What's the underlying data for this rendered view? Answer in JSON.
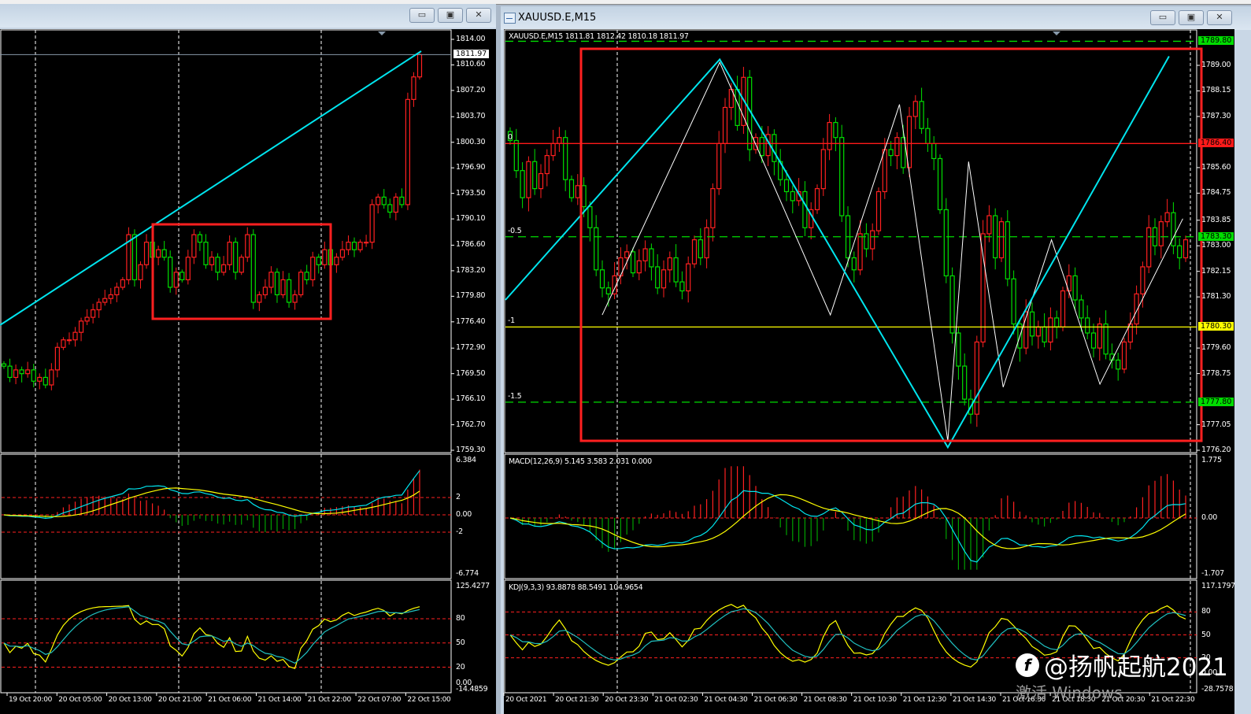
{
  "left_window": {
    "title": "",
    "buttons": {
      "minimize": "▭",
      "restore": "▣",
      "close": "✕"
    },
    "price_axis": [
      "1814.00",
      "1810.60",
      "1807.20",
      "1803.70",
      "1800.30",
      "1796.90",
      "1793.50",
      "1790.10",
      "1786.60",
      "1783.20",
      "1779.80",
      "1776.40",
      "1772.90",
      "1769.50",
      "1766.10",
      "1762.70",
      "1759.30"
    ],
    "price_range": [
      1759.3,
      1814.0
    ],
    "current_price": "1811.97",
    "macd_axis": {
      "max": "6.384",
      "l2": "2",
      "zero": "0.00",
      "lm2": "-2",
      "min": "-6.774"
    },
    "kdj_axis": {
      "max": "125.4277",
      "l80": "80",
      "l50": "50",
      "l20": "20",
      "zero": "0.00",
      "min": "-14.4859"
    },
    "time_axis": [
      "19 Oct 20:00",
      "20 Oct 05:00",
      "20 Oct 13:00",
      "20 Oct 21:00",
      "21 Oct 06:00",
      "21 Oct 14:00",
      "21 Oct 22:00",
      "22 Oct 07:00",
      "22 Oct 15:00"
    ],
    "closes": [
      1770.5,
      1769,
      1770,
      1769.5,
      1770,
      1768.5,
      1769,
      1768,
      1770,
      1773,
      1774,
      1774,
      1775,
      1776.5,
      1777,
      1778,
      1779,
      1779.5,
      1780,
      1781,
      1782,
      1788,
      1782,
      1784,
      1787,
      1785,
      1786,
      1785,
      1781,
      1783,
      1782,
      1785,
      1788,
      1787,
      1784,
      1785,
      1783,
      1784,
      1787,
      1783,
      1785,
      1788,
      1779,
      1780,
      1781,
      1783,
      1780,
      1782,
      1779,
      1780,
      1783,
      1782,
      1785,
      1784,
      1786,
      1784,
      1785,
      1786,
      1787,
      1786,
      1787,
      1787,
      1792,
      1793,
      1792,
      1791,
      1793,
      1792,
      1806,
      1809,
      1811.97
    ],
    "colors": {
      "trendline": "#00e5ee",
      "box": "#ff2020",
      "bull": "#ff2020",
      "bear": "#00e000"
    }
  },
  "right_window": {
    "title": "XAUUSD.E,M15",
    "buttons": {
      "minimize": "▭",
      "restore": "▣",
      "close": "✕"
    },
    "header": "XAUUSD.E,M15  1811.81 1812.42 1810.18 1811.97",
    "price_axis": [
      "1789.00",
      "1788.15",
      "1787.30",
      "1785.60",
      "1784.75",
      "1783.85",
      "1783.00",
      "1782.15",
      "1781.30",
      "1779.60",
      "1778.75",
      "1777.05",
      "1776.20"
    ],
    "price_range": [
      1776.2,
      1789.0
    ],
    "levels": [
      {
        "fib": "",
        "price": 1789.8,
        "label": "1789.80",
        "color": "#00dd00",
        "style": "dashed"
      },
      {
        "fib": "0",
        "price": 1786.4,
        "label": "1786.40",
        "color": "#ff1a1a",
        "style": "solid"
      },
      {
        "fib": "-0.5",
        "price": 1783.3,
        "label": "1783.30",
        "color": "#00dd00",
        "style": "dashed"
      },
      {
        "fib": "-1",
        "price": 1780.3,
        "label": "1780.30",
        "color": "#ffff00",
        "style": "solid"
      },
      {
        "fib": "-1.5",
        "price": 1777.8,
        "label": "1777.80",
        "color": "#00dd00",
        "style": "dashed"
      }
    ],
    "macd_label": "MACD(12,26,9) 5.145 3.583 2.031 0.000",
    "macd_axis": {
      "max": "1.775",
      "zero": "0.00",
      "min": "-1.707"
    },
    "kdj_label": "KDJ(9,3,3) 93.8878 88.5491 104.9654",
    "kdj_axis": {
      "max": "117.1797",
      "l80": "80",
      "l50": "50",
      "l20": "20",
      "zero": "0.00",
      "min": "-28.7578"
    },
    "time_axis": [
      "20 Oct 2021",
      "20 Oct 21:30",
      "20 Oct 23:30",
      "21 Oct 02:30",
      "21 Oct 04:30",
      "21 Oct 06:30",
      "21 Oct 08:30",
      "21 Oct 10:30",
      "21 Oct 12:30",
      "21 Oct 14:30",
      "21 Oct 16:30",
      "21 Oct 18:30",
      "21 Oct 20:30",
      "21 Oct 22:30"
    ],
    "closes": [
      1786.5,
      1785.5,
      1784.6,
      1785.8,
      1784.9,
      1785.4,
      1786.0,
      1786.4,
      1786.6,
      1785.2,
      1784.6,
      1785.0,
      1784.3,
      1783.6,
      1782.2,
      1781.6,
      1781.4,
      1782.0,
      1782.6,
      1782.8,
      1782.1,
      1782.5,
      1782.9,
      1782.3,
      1781.6,
      1782.2,
      1782.6,
      1781.8,
      1781.5,
      1782.4,
      1783.2,
      1782.6,
      1783.6,
      1784.9,
      1786.4,
      1787.6,
      1788.2,
      1787.0,
      1788.6,
      1786.2,
      1786.6,
      1786.0,
      1786.7,
      1785.8,
      1785.2,
      1784.8,
      1784.5,
      1784.8,
      1783.6,
      1784.2,
      1784.9,
      1786.2,
      1787.1,
      1786.6,
      1784.0,
      1782.6,
      1782.2,
      1783.4,
      1782.9,
      1783.5,
      1784.8,
      1786.2,
      1786.0,
      1786.6,
      1785.6,
      1787.3,
      1787.8,
      1786.9,
      1786.4,
      1785.9,
      1784.2,
      1782.0,
      1780.1,
      1779.0,
      1777.9,
      1777.4,
      1779.8,
      1783.4,
      1784.0,
      1782.6,
      1783.8,
      1781.9,
      1780.4,
      1779.6,
      1780.8,
      1780.0,
      1780.3,
      1779.8,
      1780.6,
      1780.3,
      1781.5,
      1782.0,
      1781.2,
      1780.6,
      1780.1,
      1779.6,
      1780.4,
      1779.4,
      1779.2,
      1778.9,
      1779.8,
      1780.4,
      1781.4,
      1782.3,
      1783.6,
      1783.0,
      1783.8,
      1784.1,
      1783.0,
      1782.6,
      1783.2
    ],
    "cyan_zigzag": [
      [
        0,
        1781.2
      ],
      [
        0.31,
        1789.2
      ],
      [
        0.64,
        1776.3
      ],
      [
        0.96,
        1789.3
      ]
    ],
    "white_zigzag": [
      [
        0.14,
        1780.7
      ],
      [
        0.31,
        1789.1
      ],
      [
        0.47,
        1780.7
      ],
      [
        0.57,
        1787.7
      ],
      [
        0.64,
        1776.5
      ],
      [
        0.67,
        1785.8
      ],
      [
        0.72,
        1778.3
      ],
      [
        0.79,
        1783.2
      ],
      [
        0.86,
        1778.4
      ],
      [
        0.98,
        1783.9
      ]
    ]
  },
  "watermark": {
    "logo": "f",
    "text": "@扬帆起航2021",
    "activation": "激活 Windows"
  }
}
